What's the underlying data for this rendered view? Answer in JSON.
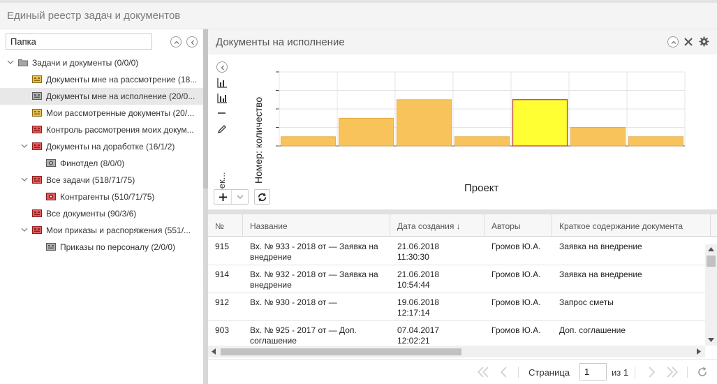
{
  "app": {
    "title": "Единый реестр задач и документов"
  },
  "left": {
    "search_value": "Папка",
    "tree": [
      {
        "label": "Задачи и документы (0/0/0)",
        "level": 0,
        "expanded": true,
        "icon": "gray-folder-icon"
      },
      {
        "label": "Документы мне на рассмотрение (18...",
        "level": 1,
        "icon": "yellow-doc-icon"
      },
      {
        "label": "Документы мне на исполнение (20/0...",
        "level": 1,
        "icon": "gray-doc-icon",
        "selected": true
      },
      {
        "label": "Мои рассмотренные документы (20/...",
        "level": 1,
        "icon": "yellow-doc-icon"
      },
      {
        "label": "Контроль рассмотрения моих докум...",
        "level": 1,
        "icon": "red-doc-icon"
      },
      {
        "label": "Документы на доработке (16/1/2)",
        "level": 1,
        "expanded": true,
        "icon": "red-doc-icon"
      },
      {
        "label": "Финотдел (8/0/0)",
        "level": 2,
        "icon": "gray-gear-icon"
      },
      {
        "label": "Все задачи (518/71/75)",
        "level": 1,
        "expanded": true,
        "icon": "red-doc-icon"
      },
      {
        "label": "Контрагенты (510/71/75)",
        "level": 2,
        "icon": "red-gear-icon"
      },
      {
        "label": "Все документы (90/3/6)",
        "level": 1,
        "icon": "red-doc-icon"
      },
      {
        "label": "Мои приказы и распоряжения (551/...",
        "level": 1,
        "expanded": true,
        "icon": "red-doc-icon"
      },
      {
        "label": "Приказы по персоналу (2/0/0)",
        "level": 2,
        "icon": "gray-doc-icon"
      }
    ]
  },
  "panel": {
    "title": "Документы на исполнение"
  },
  "chart_data": {
    "type": "bar",
    "categories": [
      "",
      "",
      "",
      "",
      "",
      "",
      ""
    ],
    "values": [
      5,
      15,
      25,
      5,
      25,
      10,
      5
    ],
    "highlight_index": 4,
    "bar_color": "#f8c35a",
    "highlight_color": "#ffff33",
    "xlabel": "Проект",
    "ylabel": "Номер: количество",
    "y2label": "Проек...",
    "ylim": [
      0,
      40
    ],
    "grid": true,
    "legend": "none"
  },
  "grid": {
    "columns": [
      "№",
      "Название",
      "Дата создания ↓",
      "Авторы",
      "Краткое содержание документа"
    ],
    "rows": [
      {
        "num": "915",
        "name": "Вх. № 933 - 2018 от — Заявка на\nвнедрение",
        "date": "21.06.2018\n11:30:30",
        "author": "Громов Ю.А.",
        "summary": "Заявка на внедрение"
      },
      {
        "num": "914",
        "name": "Вх. № 932 - 2018 от — Заявка на\nвнедрение",
        "date": "21.06.2018\n10:54:44",
        "author": "Громов Ю.А.",
        "summary": "Заявка на внедрение"
      },
      {
        "num": "912",
        "name": "Вх. № 930 - 2018 от —",
        "date": "19.06.2018\n12:17:14",
        "author": "Громов Ю.А.",
        "summary": "Запрос сметы"
      },
      {
        "num": "903",
        "name": "Вх. № 925 - 2017 от — Доп.\nсоглашение",
        "date": "07.04.2017\n12:02:21",
        "author": "Громов Ю.А.",
        "summary": "Доп. соглашение"
      }
    ]
  },
  "pager": {
    "page_label": "Страница",
    "page_value": "1",
    "of_label": "из 1"
  }
}
